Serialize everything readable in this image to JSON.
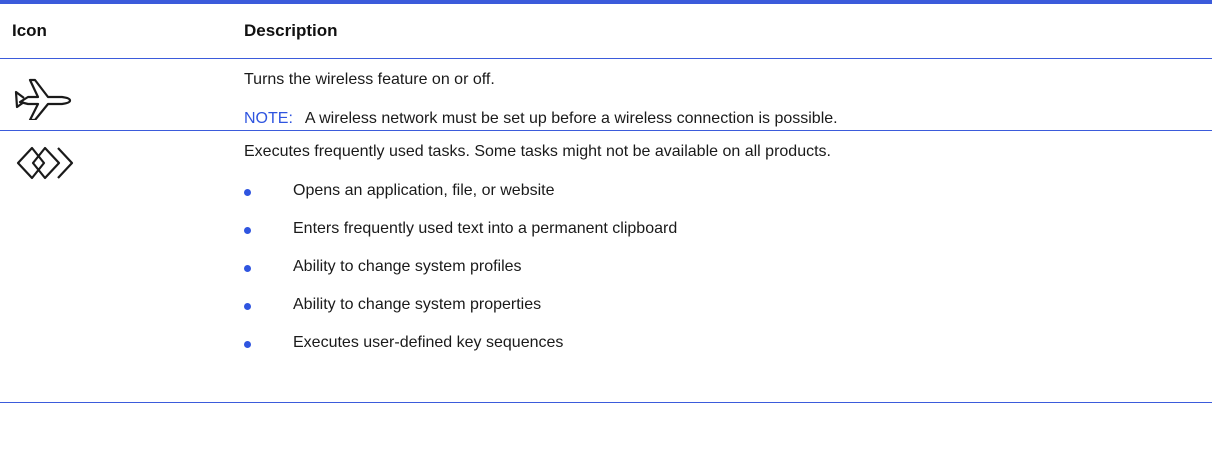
{
  "table": {
    "headers": {
      "icon": "Icon",
      "description": "Description"
    },
    "rows": [
      {
        "icon": "airplane-mode-icon",
        "description": "Turns the wireless feature on or off.",
        "note_label": "NOTE:",
        "note_text": "A wireless network must be set up before a wireless connection is possible."
      },
      {
        "icon": "programmable-key-icon",
        "description": "Executes frequently used tasks. Some tasks might not be available on all products.",
        "bullets": [
          "Opens an application, file, or website",
          "Enters frequently used text into a permanent clipboard",
          "Ability to change system profiles",
          "Ability to change system properties",
          "Executes user-defined key sequences"
        ]
      }
    ]
  },
  "colors": {
    "rule": "#3b5bdb",
    "accent": "#2f55e0",
    "text": "#1a1a1a"
  }
}
